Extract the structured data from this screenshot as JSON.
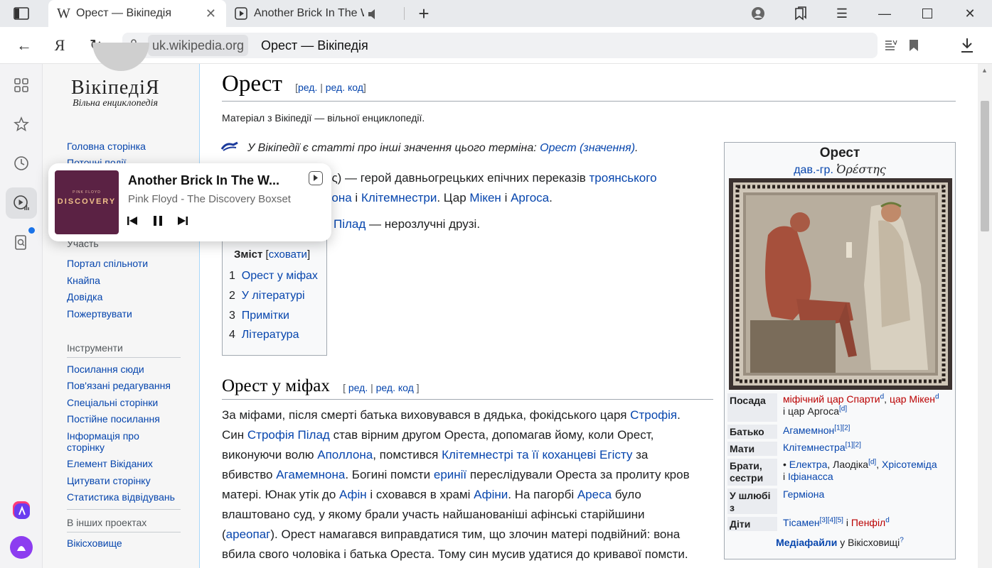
{
  "tabs": [
    {
      "title": "Орест — Вікіпедія",
      "favicon": "W",
      "active": true
    },
    {
      "title": "Another Brick In The W",
      "favicon": "play",
      "active": false
    }
  ],
  "address": {
    "domain": "uk.wikipedia.org",
    "page_title": "Орест — Вікіпедія"
  },
  "wiki_nav": {
    "logo_title": "ВікіпедіЯ",
    "logo_sub": "Вільна енциклопедія",
    "main_links": [
      "Головна сторінка",
      "Поточні події"
    ],
    "participation_head": "Участь",
    "participation_links": [
      "Портал спільноти",
      "Кнайпа",
      "Довідка",
      "Пожертвувати"
    ],
    "tools_head": "Інструменти",
    "tools_links": [
      "Посилання сюди",
      "Пов'язані редагування",
      "Спеціальні сторінки",
      "Постійне посилання",
      "Інформація про сторінку",
      "Елемент Вікіданих",
      "Цитувати сторінку",
      "Статистика відвідувань"
    ],
    "other_head": "В інших проектах",
    "other_links": [
      "Вікісховище"
    ]
  },
  "article": {
    "title": "Орест",
    "edit": "ред.",
    "edit_code": "ред. код",
    "tagline": "Матеріал з Вікіпедії — вільної енциклопедії.",
    "hatnote_text": "У Вікіпедії є статті про інші значення цього терміна:",
    "hatnote_link": "Орест (значення)",
    "intro_1a": "ης) — герой давньогрецьких епічних переказів",
    "intro_1b": "троянського",
    "intro_2a": "нона",
    "intro_2b": "і",
    "intro_2c": "Клітемнестри",
    "intro_2d": ". Цар",
    "intro_2e": "Мікен",
    "intro_2f": "і",
    "intro_2g": "Аргоса",
    "intro_2h": ".",
    "intro_3a": "Пілад",
    "intro_3b": "— нерозлучні друзі.",
    "section_title": "Орест у міфах"
  },
  "toc": {
    "heading": "Зміст",
    "hide": "сховати",
    "items": [
      {
        "num": "1",
        "label": "Орест у міфах"
      },
      {
        "num": "2",
        "label": "У літературі"
      },
      {
        "num": "3",
        "label": "Примітки"
      },
      {
        "num": "4",
        "label": "Література"
      }
    ]
  },
  "body_lines": [
    [
      [
        "t",
        "За міфами, після смерті батька виховувався в дядька, фокідського царя "
      ],
      [
        "l",
        "Строфія"
      ],
      [
        "t",
        "."
      ]
    ],
    [
      [
        "t",
        "Син "
      ],
      [
        "l",
        "Строфія Пілад"
      ],
      [
        "t",
        " став вірним другом Ореста, допомагав йому, коли Орест,"
      ]
    ],
    [
      [
        "t",
        "виконуючи волю "
      ],
      [
        "l",
        "Аполлона"
      ],
      [
        "t",
        ", помстився "
      ],
      [
        "l",
        "Клітемнестрі"
      ],
      [
        "t",
        " "
      ],
      [
        "l",
        "та її коханцеві"
      ],
      [
        "t",
        " "
      ],
      [
        "l",
        "Егісту"
      ],
      [
        "t",
        " за"
      ]
    ],
    [
      [
        "t",
        "вбивство "
      ],
      [
        "l",
        "Агамемнона"
      ],
      [
        "t",
        ". Богині помсти "
      ],
      [
        "l",
        "еринії"
      ],
      [
        "t",
        " переслідували Ореста за пролиту кров"
      ]
    ],
    [
      [
        "t",
        "матері. Юнак утік до "
      ],
      [
        "l",
        "Афін"
      ],
      [
        "t",
        " і сховався в храмі "
      ],
      [
        "l",
        "Афіни"
      ],
      [
        "t",
        ". На пагорбі "
      ],
      [
        "l",
        "Ареса"
      ],
      [
        "t",
        " було"
      ]
    ],
    [
      [
        "t",
        "влаштовано суд, у якому брали участь найшанованіші афінські старійшини"
      ]
    ],
    [
      [
        "t",
        "("
      ],
      [
        "l",
        "ареопаг"
      ],
      [
        "t",
        "). Орест намагався виправдатися тим, що злочин матері подвійний: вона"
      ]
    ],
    [
      [
        "t",
        "вбила свого чоловіка і батька Ореста. Тому син мусив удатися до кривавої помсти."
      ]
    ]
  ],
  "infobox": {
    "title": "Орест",
    "sub_link": "дав.-гр.",
    "sub_greek": "Ὀρέστης",
    "rows": [
      {
        "k": "Посада",
        "v": [
          [
            "r",
            "міфічний цар Спарти"
          ],
          [
            "s",
            "d"
          ],
          [
            "t",
            ", "
          ],
          [
            "r",
            "цар Мікен"
          ],
          [
            "s",
            "d"
          ],
          [
            "br",
            ""
          ],
          [
            "t",
            "і цар Аргоса"
          ],
          [
            "s",
            "[d]"
          ]
        ]
      },
      {
        "k": "Батько",
        "v": [
          [
            "l",
            "Агамемнон"
          ],
          [
            "s",
            "[1][2]"
          ]
        ]
      },
      {
        "k": "Мати",
        "v": [
          [
            "l",
            "Клітемнестра"
          ],
          [
            "s",
            "[1][2]"
          ]
        ]
      },
      {
        "k": "Брати, сестри",
        "v": [
          [
            "t",
            " • "
          ],
          [
            "l",
            "Електра"
          ],
          [
            "t",
            ", Лаодіка"
          ],
          [
            "s",
            "[d]"
          ],
          [
            "t",
            ", "
          ],
          [
            "l",
            "Хрісотеміда"
          ],
          [
            "br",
            ""
          ],
          [
            "t",
            "і "
          ],
          [
            "l",
            "Іфіанасса"
          ]
        ]
      },
      {
        "k": "У шлюбі з",
        "v": [
          [
            "l",
            "Герміона"
          ]
        ]
      },
      {
        "k": "Діти",
        "v": [
          [
            "l",
            "Тісамен"
          ],
          [
            "s",
            "[3][4][5]"
          ],
          [
            "t",
            " і "
          ],
          [
            "r",
            "Пенфіл"
          ],
          [
            "s",
            "d"
          ]
        ]
      }
    ],
    "footer_link": "Медіафайли",
    "footer_text": "у Вікісховищі",
    "footer_sup": "?"
  },
  "media_player": {
    "song": "Another Brick In The W...",
    "artist": "Pink Floyd - The Discovery Boxset",
    "cover_band": "PINK FLOYD",
    "cover_title": "DISCOVERY"
  },
  "colors": {
    "link": "#0645ad",
    "redlink": "#ba0000",
    "cover": "#5b2244"
  }
}
